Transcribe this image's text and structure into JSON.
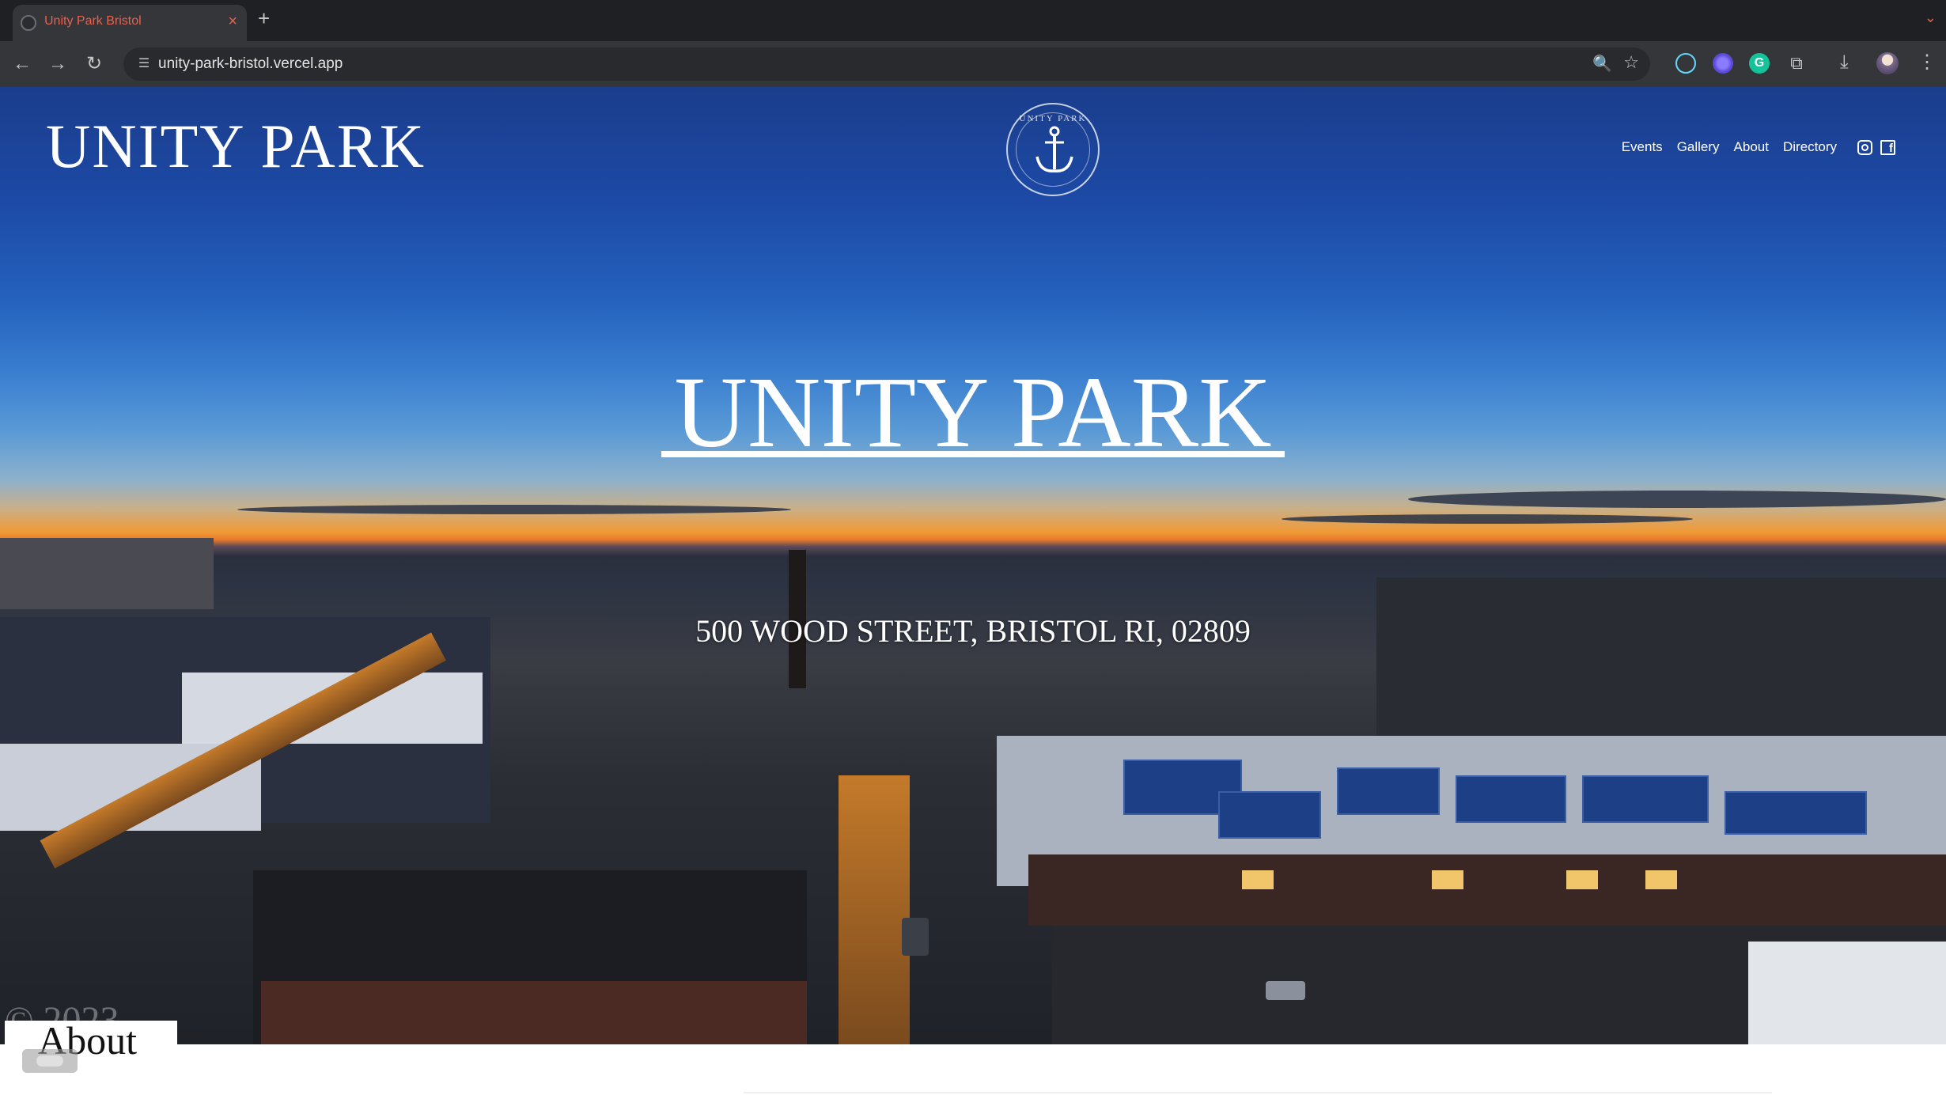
{
  "browser": {
    "tab_title": "Unity Park Bristol",
    "tab_close_icon": "×",
    "new_tab_icon": "+",
    "url": "unity-park-bristol.vercel.app",
    "back_icon": "←",
    "forward_icon": "→",
    "reload_icon": "↻",
    "zoom_icon": "🔍",
    "star_icon": "☆",
    "download_icon": "⤓",
    "more_icon": "⋮",
    "tab_menu_icon": "⌄",
    "grammarly_letter": "G"
  },
  "site": {
    "logo_text": "UNITY PARK",
    "emblem_text": "UNITY PARK",
    "nav": [
      "Events",
      "Gallery",
      "About",
      "Directory"
    ],
    "hero_title": "UNITY PARK",
    "address": "500 WOOD STREET, BRISTOL RI, 02809",
    "about_heading": "About",
    "copyright_ghost": "© 2023"
  },
  "colors": {
    "tab_accent": "#e8614f",
    "chrome_bg": "#35363a",
    "sky_top": "#1b3d8c",
    "sunset": "#f09a35"
  }
}
